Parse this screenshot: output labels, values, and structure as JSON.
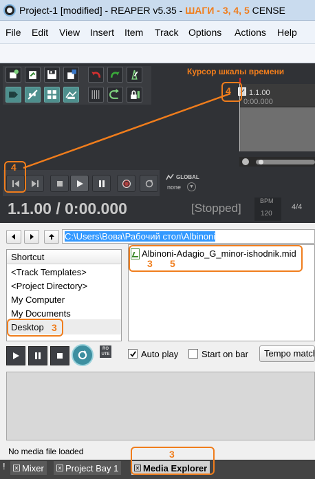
{
  "window": {
    "title": "Project-1 [modified] - REAPER v5.35 - ",
    "title_annotation": "ШАГИ - 3, 4, 5",
    "title_suffix": "CENSE"
  },
  "menu": [
    "File",
    "Edit",
    "View",
    "Insert",
    "Item",
    "Track",
    "Options",
    "Actions",
    "Help"
  ],
  "annotations": {
    "timeline_cursor_label": "Курсор шкалы времени",
    "step_4_cursor": "4",
    "step_4_button": "4",
    "step_3_desktop": "3",
    "step_3_file": "3",
    "step_5_file": "5",
    "step_3_tab": "3",
    "accent_color": "#f07d1c"
  },
  "toolbar_icons": [
    "new-track-icon",
    "open-project-icon",
    "save-project-icon",
    "project-settings-icon",
    "undo-icon",
    "redo-icon",
    "metronome-icon",
    "grid-snap-icon",
    "ripple-edit-icon",
    "item-grouping-icon",
    "envelope-lock-icon",
    "snap-icon",
    "auto-crossfade-icon",
    "locking-icon"
  ],
  "ruler": {
    "bar": "1.1.00",
    "time": "0:00.000"
  },
  "transport": {
    "global_label": "GLOBAL",
    "global_value": "none",
    "position": "1.1.00 / 0:00.000",
    "status": "[Stopped]",
    "bpm_label": "BPM",
    "bpm_value": "120",
    "time_signature": "4/4"
  },
  "media_explorer": {
    "path": "C:\\Users\\Вова\\Рабочий стол\\Albinoni",
    "shortcut_header": "Shortcut",
    "shortcuts": [
      "<Track Templates>",
      "<Project Directory>",
      "My Computer",
      "My Documents",
      "Desktop"
    ],
    "selected_shortcut": "Desktop",
    "files": [
      "Albinoni-Adagio_G_minor-ishodnik.mid"
    ],
    "route_label": "RO UTE",
    "auto_play_label": "Auto play",
    "auto_play_checked": true,
    "start_on_bar_label": "Start on bar",
    "start_on_bar_checked": false,
    "tempo_button": "Tempo match",
    "status": "No media file loaded"
  },
  "docker_tabs": {
    "bang": "!",
    "tabs": [
      "Mixer",
      "Project Bay 1",
      "Media Explorer"
    ],
    "active": "Media Explorer"
  }
}
